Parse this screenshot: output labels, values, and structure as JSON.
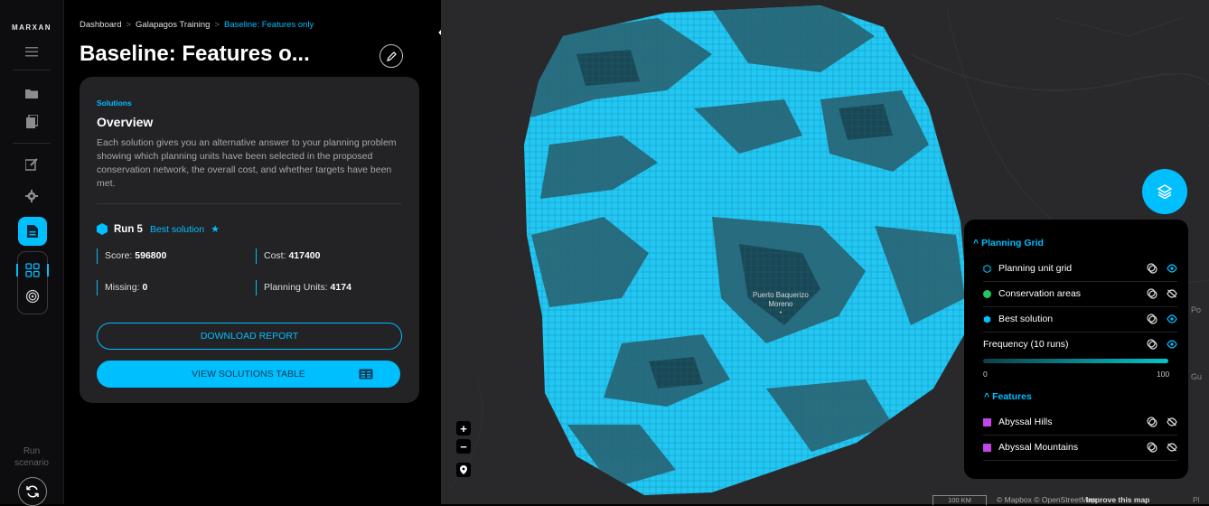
{
  "app": {
    "brand": "MARXAN"
  },
  "rail": {
    "run_label": "Run\nscenario"
  },
  "breadcrumb": {
    "items": [
      "Dashboard",
      "Galapagos Training"
    ],
    "current": "Baseline: Features only"
  },
  "page": {
    "title": "Baseline: Features o..."
  },
  "solutions": {
    "section_label": "Solutions",
    "heading": "Overview",
    "description": "Each solution gives you an alternative answer to your planning problem showing which planning units have been selected in the proposed conservation network, the overall cost, and whether targets have been met.",
    "run_name": "Run 5",
    "best_label": "Best solution",
    "stats": {
      "score_label": "Score:",
      "score_value": "596800",
      "cost_label": "Cost:",
      "cost_value": "417400",
      "missing_label": "Missing:",
      "missing_value": "0",
      "pu_label": "Planning Units:",
      "pu_value": "4174"
    },
    "download_label": "DOWNLOAD REPORT",
    "view_table_label": "VIEW SOLUTIONS TABLE"
  },
  "map": {
    "city_label_line1": "Puerto Baquerizo",
    "city_label_line2": "Moreno",
    "scale_label": "100 KM",
    "attribution": "© Mapbox © OpenStreetMap",
    "improve_label": "Improve this map",
    "edge_labels": [
      "Po",
      "Gu",
      "Pl"
    ],
    "colors": {
      "grid_light": "#22c8f4",
      "grid_dark": "#2a5a66",
      "background": "#29292c",
      "accent": "#00bfff"
    }
  },
  "legend": {
    "planning_grid_heading": "Planning Grid",
    "layers": [
      {
        "label": "Planning unit grid",
        "visible": true
      },
      {
        "label": "Conservation areas",
        "visible": false,
        "color": "#22c55e"
      },
      {
        "label": "Best solution",
        "visible": true,
        "color": "#00bfff"
      },
      {
        "label": "Frequency (10 runs)",
        "visible": true
      }
    ],
    "frequency_min": "0",
    "frequency_max": "100",
    "features_heading": "Features",
    "features": [
      {
        "label": "Abyssal Hills",
        "visible": false,
        "color": "#c147e9"
      },
      {
        "label": "Abyssal Mountains",
        "visible": false,
        "color": "#c147e9"
      }
    ]
  }
}
